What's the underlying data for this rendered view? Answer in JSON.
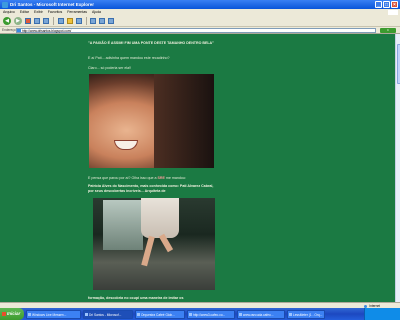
{
  "window": {
    "title": "Dri Santos - Microsoft Internet Explorer"
  },
  "menu": [
    "Arquivo",
    "Editar",
    "Exibir",
    "Favoritos",
    "Ferramentas",
    "Ajuda"
  ],
  "address": {
    "label": "Endereço",
    "url": "http://www.drisantos.blogspot.com/",
    "go": "Ir"
  },
  "post": {
    "heading": "\"A PAIXÃO É ASSIM! FIM UMA PONTE DESTE TAMANHO DENTRO BELA\"",
    "line1": "E aí Pati... adivinha quem mandou este recadinho?",
    "line2": "Claro... só poderia ser ela!!",
    "caption1_pre": "E pensa que parou por aí? Olha isso que a ",
    "caption1_name": "SRE",
    "caption1_post": " me mandou:",
    "caption2": "Patrícia Alves do Nascimento, mais conhecida como: Pati Alvarez Cabral, por seus descobertas incríveis... Arquiteta de",
    "caption3": "formação, descobria no ocupi uma maneira de imitar os"
  },
  "status": {
    "zone": "Internet"
  },
  "taskbar": {
    "start": "Iniciar",
    "tasks": [
      "Windows Live Messen...",
      "Dri Santos - Microsof...",
      "Orquestra Cafeé Glob...",
      "http://www3.cafeo.co...",
      "www.rancuda.cafeo...",
      "LessMeter (1 - Orq..."
    ],
    "clock": ""
  }
}
